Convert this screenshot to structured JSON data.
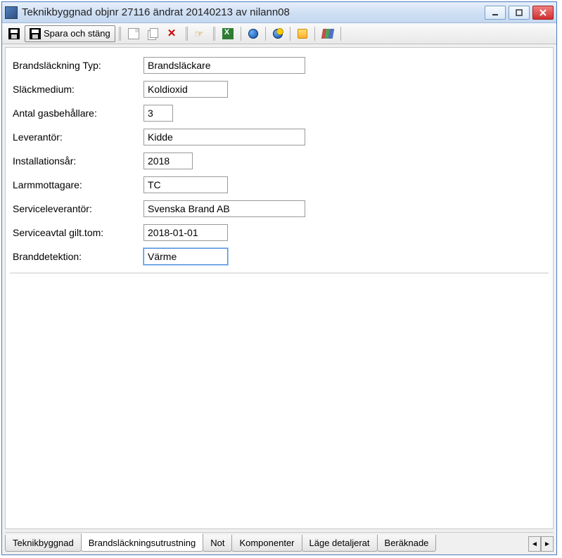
{
  "window": {
    "title": "Teknikbyggnad  objnr 27116 ändrat 20140213 av nilann08"
  },
  "toolbar": {
    "save_close_label": "Spara och stäng"
  },
  "form": {
    "rows": [
      {
        "label": "Brandsläckning Typ:",
        "value": "Brandsläckare",
        "widthClass": "w230"
      },
      {
        "label": "Släckmedium:",
        "value": "Koldioxid",
        "widthClass": "w120"
      },
      {
        "label": "Antal gasbehållare:",
        "value": "3",
        "widthClass": "w42"
      },
      {
        "label": "Leverantör:",
        "value": "Kidde",
        "widthClass": "w230"
      },
      {
        "label": "Installationsår:",
        "value": "2018",
        "widthClass": "w70"
      },
      {
        "label": "Larmmottagare:",
        "value": "TC",
        "widthClass": "w120"
      },
      {
        "label": "Serviceleverantör:",
        "value": "Svenska Brand AB",
        "widthClass": "w230"
      },
      {
        "label": "Serviceavtal gilt.tom:",
        "value": "2018-01-01",
        "widthClass": "w120"
      },
      {
        "label": "Branddetektion:",
        "value": "Värme",
        "widthClass": "w120",
        "active": true
      }
    ]
  },
  "tabs": {
    "items": [
      {
        "label": "Teknikbyggnad",
        "active": false
      },
      {
        "label": "Brandsläckningsutrustning",
        "active": true
      },
      {
        "label": "Not",
        "active": false
      },
      {
        "label": "Komponenter",
        "active": false
      },
      {
        "label": "Läge detaljerat",
        "active": false
      },
      {
        "label": "Beräknade",
        "active": false
      }
    ]
  }
}
